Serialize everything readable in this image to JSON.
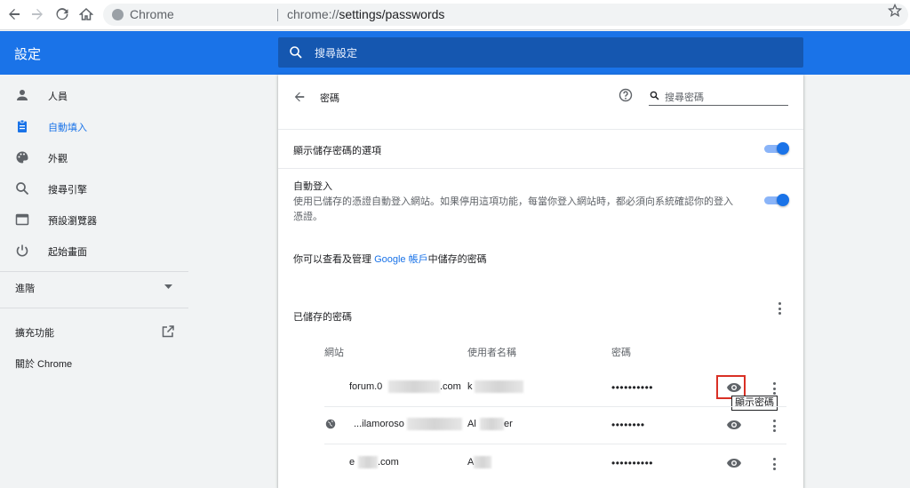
{
  "browser": {
    "site_name": "Chrome",
    "url_scheme": "chrome://",
    "url_path": "settings/passwords"
  },
  "header": {
    "title": "設定",
    "search_placeholder": "搜尋設定"
  },
  "sidebar": {
    "items": [
      {
        "label": "人員",
        "icon": "person-icon"
      },
      {
        "label": "自動填入",
        "icon": "clipboard-icon",
        "active": true
      },
      {
        "label": "外觀",
        "icon": "palette-icon"
      },
      {
        "label": "搜尋引擎",
        "icon": "search-icon"
      },
      {
        "label": "預設瀏覽器",
        "icon": "browser-icon"
      },
      {
        "label": "起始畫面",
        "icon": "power-icon"
      }
    ],
    "advanced": "進階",
    "extensions": "擴充功能",
    "about": "關於 Chrome"
  },
  "passwords": {
    "title": "密碼",
    "search_placeholder": "搜尋密碼",
    "offer_save_label": "顯示儲存密碼的選項",
    "auto_signin_title": "自動登入",
    "auto_signin_desc_1": "使用已儲存的憑證自動登入網站。如果停用這項功能，每當你登入網站時，都必須向系統確認你的登入",
    "auto_signin_desc_2": "憑證。",
    "google_prefix": "你可以查看及管理",
    "google_link": "Google 帳戶",
    "google_suffix": "中儲存的密碼",
    "saved_title": "已儲存的密碼",
    "col_site": "網站",
    "col_username": "使用者名稱",
    "col_password": "密碼",
    "rows": [
      {
        "site_start": "forum.0",
        "site_end": ".com",
        "username": "k",
        "password": "••••••••••"
      },
      {
        "site_start": "...ilamoroso",
        "site_end": "",
        "username": "Al",
        "username_end": "er",
        "password": "••••••••"
      },
      {
        "site_start": "e",
        "site_end": ".com",
        "username": "A",
        "password": "••••••••••"
      }
    ],
    "tooltip": "顯示密碼"
  },
  "colors": {
    "accent": "#1a73e8",
    "highlight": "#d93025"
  }
}
